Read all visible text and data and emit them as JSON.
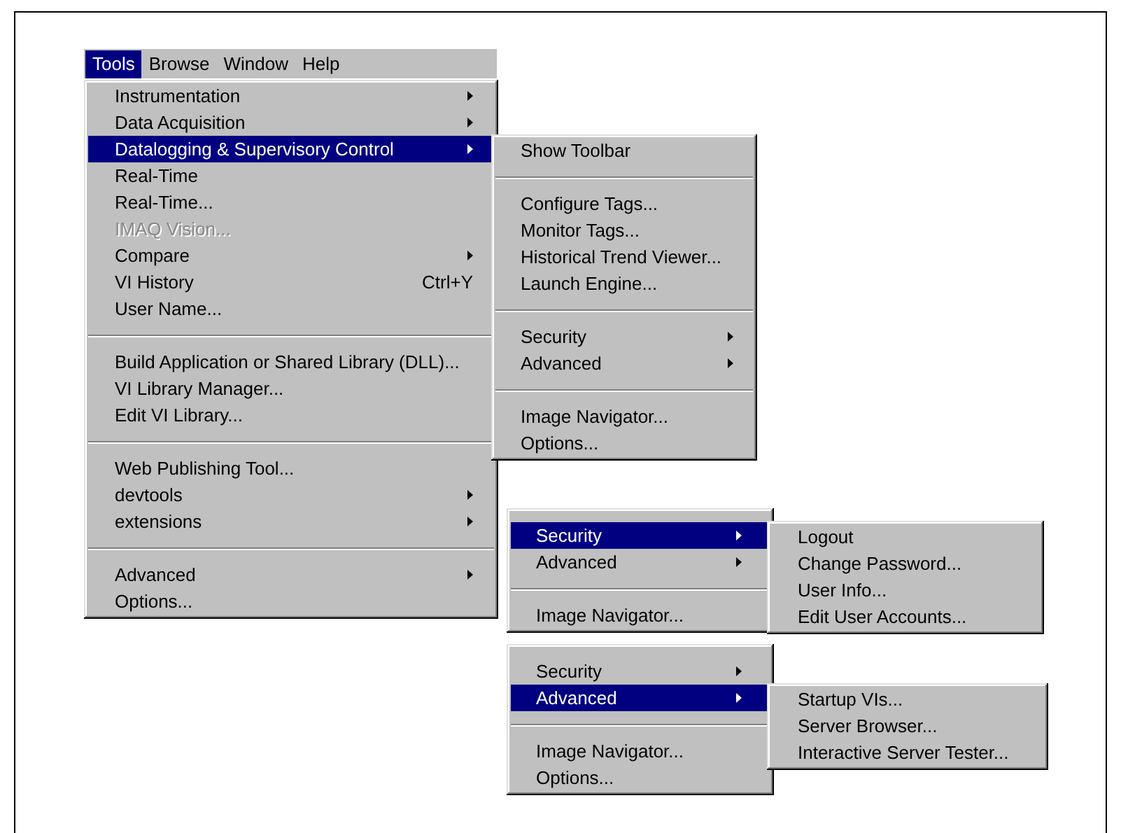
{
  "menu_bar": [
    {
      "label": "Tools",
      "selected": true
    },
    {
      "label": "Browse",
      "selected": false
    },
    {
      "label": "Window",
      "selected": false
    },
    {
      "label": "Help",
      "selected": false
    }
  ],
  "menus": [
    {
      "items": [
        {
          "kind": "item",
          "label": "Instrumentation",
          "submenu": true,
          "selected": false,
          "disabled": false
        },
        {
          "kind": "item",
          "label": "Data Acquisition",
          "submenu": true,
          "selected": false,
          "disabled": false
        },
        {
          "kind": "item",
          "label": "Datalogging & Supervisory Control",
          "submenu": true,
          "selected": true,
          "disabled": false
        },
        {
          "kind": "item",
          "label": "Real-Time",
          "submenu": false,
          "selected": false,
          "disabled": false
        },
        {
          "kind": "item",
          "label": "Real-Time...",
          "submenu": false,
          "selected": false,
          "disabled": false
        },
        {
          "kind": "item",
          "label": "IMAQ Vision...",
          "submenu": false,
          "selected": false,
          "disabled": true
        },
        {
          "kind": "item",
          "label": "Compare",
          "submenu": true,
          "selected": false,
          "disabled": false
        },
        {
          "kind": "item",
          "label": "VI History",
          "shortcut": "Ctrl+Y",
          "submenu": false,
          "selected": false,
          "disabled": false
        },
        {
          "kind": "item",
          "label": "User Name...",
          "submenu": false,
          "selected": false,
          "disabled": false
        },
        {
          "kind": "separator"
        },
        {
          "kind": "item",
          "label": "Build Application or Shared Library (DLL)...",
          "submenu": false,
          "selected": false,
          "disabled": false
        },
        {
          "kind": "item",
          "label": "VI Library Manager...",
          "submenu": false,
          "selected": false,
          "disabled": false
        },
        {
          "kind": "item",
          "label": "Edit VI Library...",
          "submenu": false,
          "selected": false,
          "disabled": false
        },
        {
          "kind": "separator"
        },
        {
          "kind": "item",
          "label": "Web Publishing Tool...",
          "submenu": false,
          "selected": false,
          "disabled": false
        },
        {
          "kind": "item",
          "label": "devtools",
          "submenu": true,
          "selected": false,
          "disabled": false
        },
        {
          "kind": "item",
          "label": "extensions",
          "submenu": true,
          "selected": false,
          "disabled": false
        },
        {
          "kind": "separator"
        },
        {
          "kind": "item",
          "label": "Advanced",
          "submenu": true,
          "selected": false,
          "disabled": false
        },
        {
          "kind": "item",
          "label": "Options...",
          "submenu": false,
          "selected": false,
          "disabled": false
        }
      ]
    },
    {
      "items": [
        {
          "kind": "item",
          "label": "Show Toolbar",
          "submenu": false,
          "selected": false,
          "disabled": false
        },
        {
          "kind": "separator"
        },
        {
          "kind": "item",
          "label": "Configure Tags...",
          "submenu": false,
          "selected": false,
          "disabled": false
        },
        {
          "kind": "item",
          "label": "Monitor Tags...",
          "submenu": false,
          "selected": false,
          "disabled": false
        },
        {
          "kind": "item",
          "label": "Historical Trend Viewer...",
          "submenu": false,
          "selected": false,
          "disabled": false
        },
        {
          "kind": "item",
          "label": "Launch Engine...",
          "submenu": false,
          "selected": false,
          "disabled": false
        },
        {
          "kind": "separator"
        },
        {
          "kind": "item",
          "label": "Security",
          "submenu": true,
          "selected": false,
          "disabled": false
        },
        {
          "kind": "item",
          "label": "Advanced",
          "submenu": true,
          "selected": false,
          "disabled": false
        },
        {
          "kind": "separator"
        },
        {
          "kind": "item",
          "label": "Image Navigator...",
          "submenu": false,
          "selected": false,
          "disabled": false
        },
        {
          "kind": "item",
          "label": "Options...",
          "submenu": false,
          "selected": false,
          "disabled": false
        }
      ]
    },
    {
      "items": [
        {
          "kind": "item",
          "label": "Security",
          "submenu": true,
          "selected": true,
          "disabled": false
        },
        {
          "kind": "item",
          "label": "Advanced",
          "submenu": true,
          "selected": false,
          "disabled": false
        },
        {
          "kind": "separator"
        },
        {
          "kind": "item",
          "label": "Image Navigator...",
          "submenu": false,
          "selected": false,
          "disabled": false
        }
      ]
    },
    {
      "items": [
        {
          "kind": "item",
          "label": "Logout",
          "submenu": false,
          "selected": false,
          "disabled": false
        },
        {
          "kind": "item",
          "label": "Change Password...",
          "submenu": false,
          "selected": false,
          "disabled": false
        },
        {
          "kind": "item",
          "label": "User Info...",
          "submenu": false,
          "selected": false,
          "disabled": false
        },
        {
          "kind": "item",
          "label": "Edit User Accounts...",
          "submenu": false,
          "selected": false,
          "disabled": false
        }
      ]
    },
    {
      "items": [
        {
          "kind": "item",
          "label": "Security",
          "submenu": true,
          "selected": false,
          "disabled": false
        },
        {
          "kind": "item",
          "label": "Advanced",
          "submenu": true,
          "selected": true,
          "disabled": false
        },
        {
          "kind": "separator"
        },
        {
          "kind": "item",
          "label": "Image Navigator...",
          "submenu": false,
          "selected": false,
          "disabled": false
        },
        {
          "kind": "item",
          "label": "Options...",
          "submenu": false,
          "selected": false,
          "disabled": false
        }
      ]
    },
    {
      "items": [
        {
          "kind": "item",
          "label": "Startup VIs...",
          "submenu": false,
          "selected": false,
          "disabled": false
        },
        {
          "kind": "item",
          "label": "Server Browser...",
          "submenu": false,
          "selected": false,
          "disabled": false
        },
        {
          "kind": "item",
          "label": "Interactive Server Tester...",
          "submenu": false,
          "selected": false,
          "disabled": false
        }
      ]
    }
  ]
}
